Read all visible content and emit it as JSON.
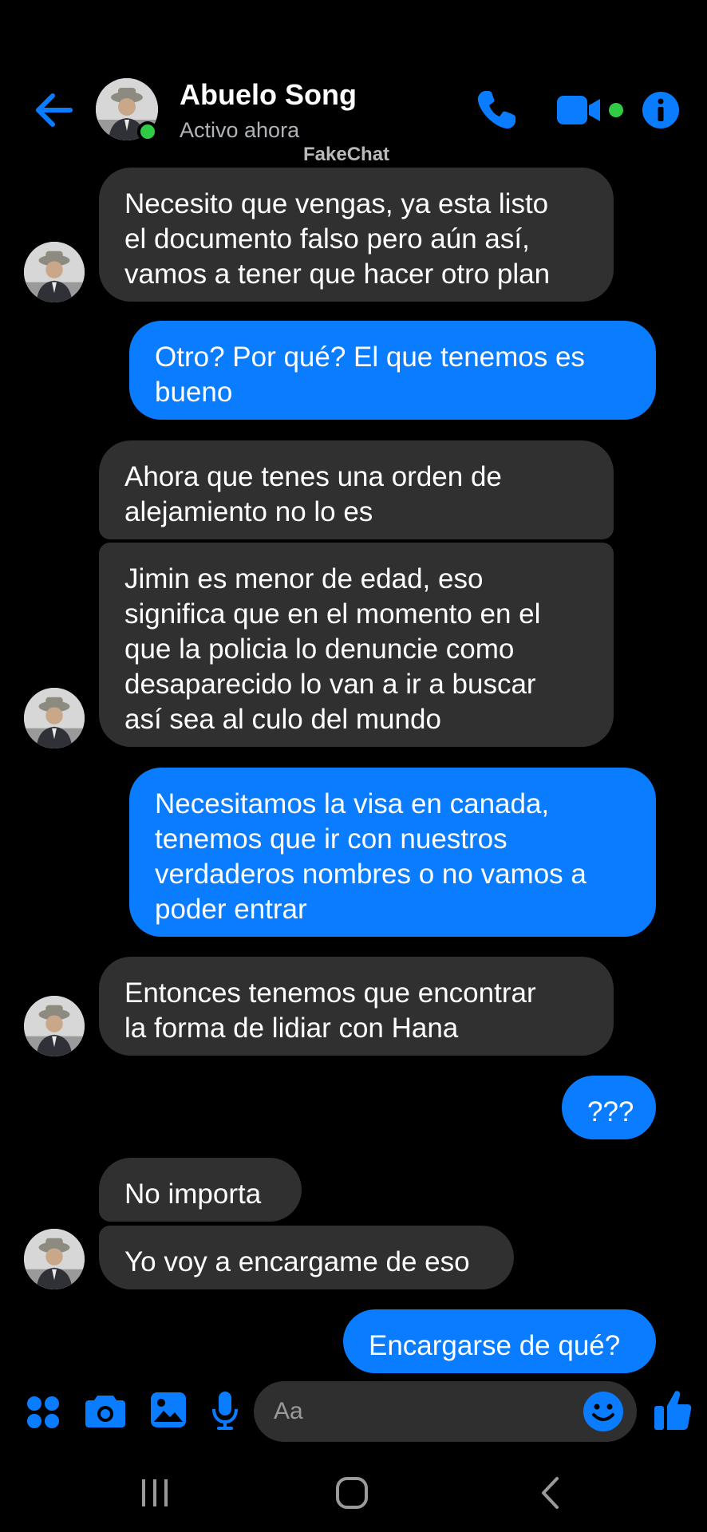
{
  "contact": {
    "name": "Abuelo Song",
    "status": "Activo ahora"
  },
  "watermark": "FakeChat",
  "messages": [
    {
      "side": "in",
      "lines": [
        "Necesito que vengas, ya esta listo",
        "el documento falso pero aún así,",
        "vamos a tener que hacer otro plan"
      ]
    },
    {
      "side": "out",
      "lines": [
        "Otro? Por qué? El que tenemos es",
        "bueno"
      ]
    },
    {
      "side": "in",
      "lines": [
        "Ahora que tenes una orden de",
        "alejamiento no lo es"
      ]
    },
    {
      "side": "in",
      "lines": [
        "Jimin es menor de edad, eso",
        "significa que en el momento en el",
        "que la policia lo denuncie como",
        "desaparecido lo van a ir a buscar",
        "así sea al culo del mundo"
      ]
    },
    {
      "side": "out",
      "lines": [
        "Necesitamos la visa en canada,",
        "tenemos que ir con nuestros",
        "verdaderos nombres o no vamos a",
        "poder entrar"
      ]
    },
    {
      "side": "in",
      "lines": [
        "Entonces tenemos que encontrar",
        "la forma de lidiar con Hana"
      ]
    },
    {
      "side": "out",
      "lines": [
        "???"
      ]
    },
    {
      "side": "in",
      "lines": [
        "No importa"
      ]
    },
    {
      "side": "in",
      "lines": [
        "Yo voy a encargame de eso"
      ]
    },
    {
      "side": "out",
      "lines": [
        "Encargarse de qué?"
      ]
    }
  ],
  "composer": {
    "placeholder": "Aa"
  },
  "colors": {
    "accent": "#0a7cff",
    "incoming": "#303030",
    "online": "#31cc46",
    "background": "#000000"
  },
  "icons": [
    "back-arrow-icon",
    "phone-icon",
    "video-camera-icon",
    "info-icon",
    "apps-icon",
    "camera-icon",
    "gallery-icon",
    "microphone-icon",
    "emoji-icon",
    "thumbs-up-icon",
    "recents-icon",
    "home-icon",
    "nav-back-icon"
  ]
}
